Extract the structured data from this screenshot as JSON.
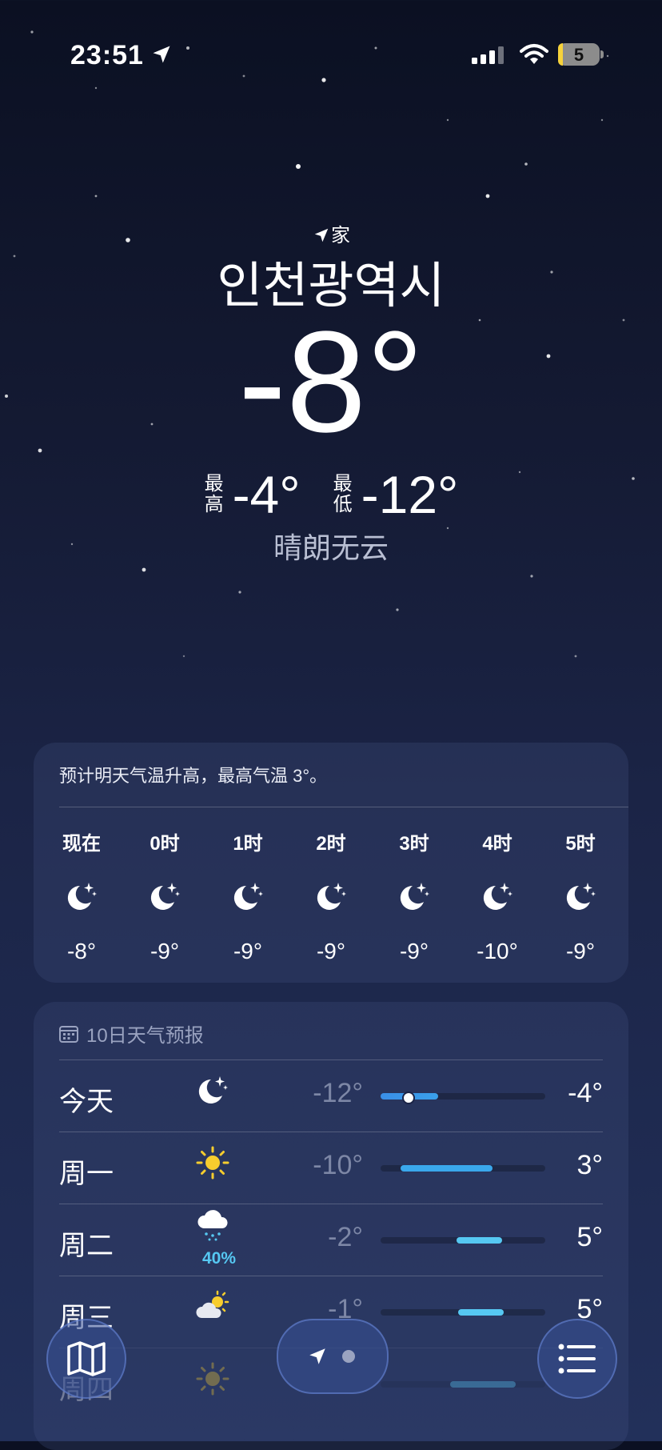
{
  "status_bar": {
    "time": "23:51",
    "battery": "5"
  },
  "location": {
    "home_label": "家",
    "city": "인천광역시"
  },
  "current": {
    "temp": "-8°",
    "high_label": "最\n高",
    "high": "-4°",
    "low_label": "最\n低",
    "low": "-12°",
    "condition": "晴朗无云"
  },
  "hourly": {
    "summary": "预计明天气温升高，最高气温 3°。",
    "items": [
      {
        "label": "现在",
        "icon": "moon-stars-icon",
        "temp": "-8°"
      },
      {
        "label": "0时",
        "icon": "moon-stars-icon",
        "temp": "-9°"
      },
      {
        "label": "1时",
        "icon": "moon-stars-icon",
        "temp": "-9°"
      },
      {
        "label": "2时",
        "icon": "moon-stars-icon",
        "temp": "-9°"
      },
      {
        "label": "3时",
        "icon": "moon-stars-icon",
        "temp": "-9°"
      },
      {
        "label": "4时",
        "icon": "moon-stars-icon",
        "temp": "-10°"
      },
      {
        "label": "5时",
        "icon": "moon-stars-icon",
        "temp": "-9°"
      }
    ]
  },
  "daily": {
    "title": "10日天气预报",
    "rows": [
      {
        "day": "今天",
        "icon": "moon-stars-icon",
        "low": "-12°",
        "high": "-4°",
        "range_start": 0.0,
        "range_end": 0.35,
        "current_marker": 0.16
      },
      {
        "day": "周一",
        "icon": "sun-icon",
        "low": "-10°",
        "high": "3°",
        "range_start": 0.12,
        "range_end": 0.68
      },
      {
        "day": "周二",
        "icon": "cloud-snow-icon",
        "precip": "40%",
        "low": "-2°",
        "high": "5°",
        "range_start": 0.46,
        "range_end": 0.74
      },
      {
        "day": "周三",
        "icon": "partly-cloudy-icon",
        "low": "-1°",
        "high": "5°",
        "range_start": 0.47,
        "range_end": 0.75
      },
      {
        "day": "周四",
        "icon": "sun-icon",
        "low": "",
        "high": "",
        "range_start": 0.42,
        "range_end": 0.82
      }
    ]
  },
  "colors": {
    "accent_blue": "#3a8fe8",
    "precip": "#56c8f2"
  }
}
